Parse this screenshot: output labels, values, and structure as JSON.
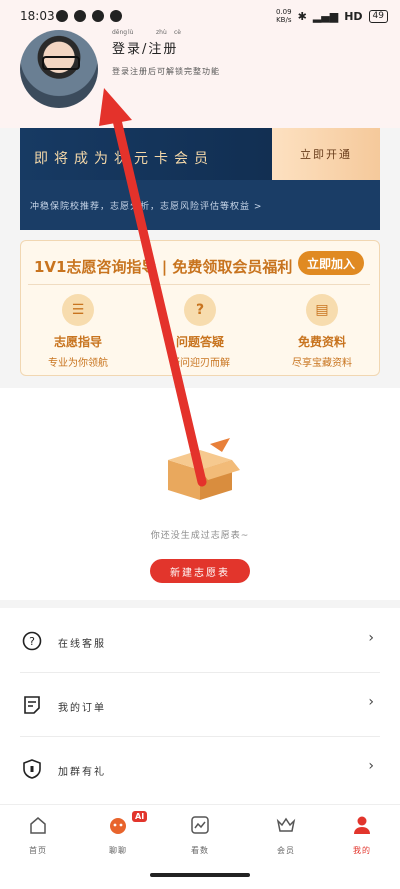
{
  "status": {
    "time": "18:03",
    "net": "0.09",
    "net_unit": "KB/s",
    "signal": "HD",
    "battery": "49"
  },
  "header": {
    "pinyin": [
      "dēng",
      "lù",
      "zhù",
      "cè"
    ],
    "login_label": "登录/注册",
    "subtitle": "登录注册后可解锁完整功能"
  },
  "member": {
    "title": "即将成为状元卡会员",
    "open_label": "立即开通",
    "sub": "冲稳保院校推荐，志愿分析，志愿风险评估等权益 >"
  },
  "promo": {
    "title": "1V1志愿咨询指导 | 免费领取会员福利",
    "join_label": "立即加入",
    "features": [
      {
        "icon": "guide-icon",
        "title": "志愿指导",
        "sub": "专业为你领航"
      },
      {
        "icon": "question-icon",
        "title": "问题答疑",
        "sub": "疑问迎刃而解"
      },
      {
        "icon": "book-icon",
        "title": "免费资料",
        "sub": "尽享宝藏资料"
      }
    ]
  },
  "empty": {
    "text": "你还没生成过志愿表~",
    "button": "新建志愿表"
  },
  "menu": [
    {
      "icon": "help-circle-icon",
      "label": "在线客服"
    },
    {
      "icon": "order-icon",
      "label": "我的订单"
    },
    {
      "icon": "shield-icon",
      "label": "加群有礼"
    }
  ],
  "tabs": [
    {
      "icon": "home-icon",
      "label": "首页"
    },
    {
      "icon": "ai-mascot-icon",
      "label": "聊聊",
      "badge": "AI"
    },
    {
      "icon": "chart-icon",
      "label": "看数"
    },
    {
      "icon": "crown-icon",
      "label": "会员"
    },
    {
      "icon": "user-icon",
      "label": "我的",
      "active": true
    }
  ],
  "colors": {
    "accent": "#e2352c",
    "gold": "#c8741f",
    "navy": "#173a63"
  }
}
